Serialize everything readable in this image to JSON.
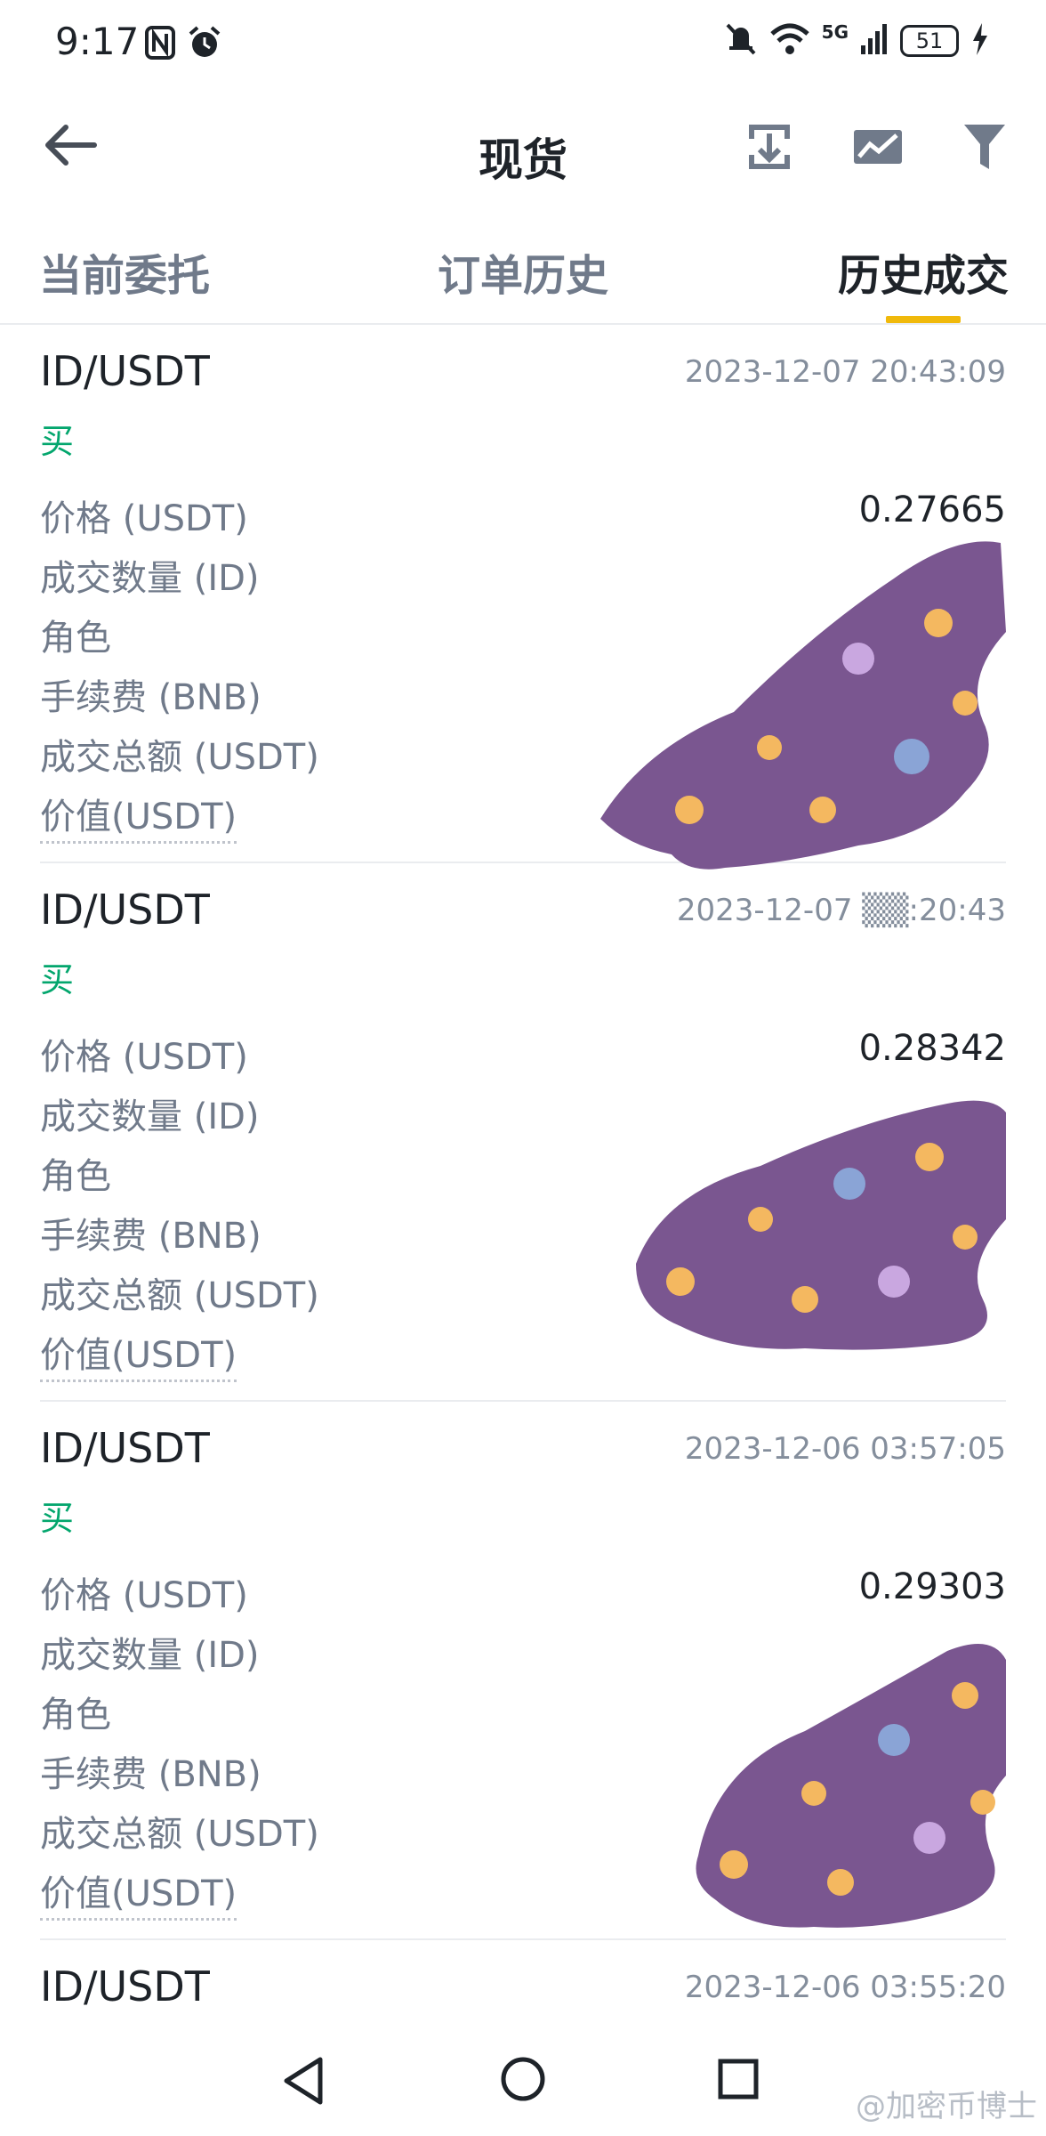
{
  "status": {
    "time": "9:17",
    "network_label": "5G",
    "battery": "51"
  },
  "header": {
    "title": "现货",
    "icons": [
      "back-icon",
      "export-icon",
      "chart-icon",
      "filter-icon"
    ]
  },
  "tabs": [
    {
      "label": "当前委托",
      "active": false
    },
    {
      "label": "订单历史",
      "active": false
    },
    {
      "label": "历史成交",
      "active": true
    }
  ],
  "labels": {
    "price": "价格 (USDT)",
    "quantity": "成交数量 (ID)",
    "role": "角色",
    "fee": "手续费 (BNB)",
    "total": "成交总额 (USDT)",
    "value": "价值(USDT)"
  },
  "trades": [
    {
      "pair": "ID/USDT",
      "time": "2023-12-07 20:43:09",
      "side": "买",
      "price": "0.27665"
    },
    {
      "pair": "ID/USDT",
      "time": "2023-12-07 ▒▒:20:43",
      "side": "买",
      "price": "0.28342"
    },
    {
      "pair": "ID/USDT",
      "time": "2023-12-06 03:57:05",
      "side": "买",
      "price": "0.29303"
    },
    {
      "pair": "ID/USDT",
      "time": "2023-12-06 03:55:20"
    }
  ],
  "watermark": "@加密币博士",
  "colors": {
    "buy": "#03a66d",
    "accent": "#f0b90b",
    "redaction": "#7a5690"
  }
}
